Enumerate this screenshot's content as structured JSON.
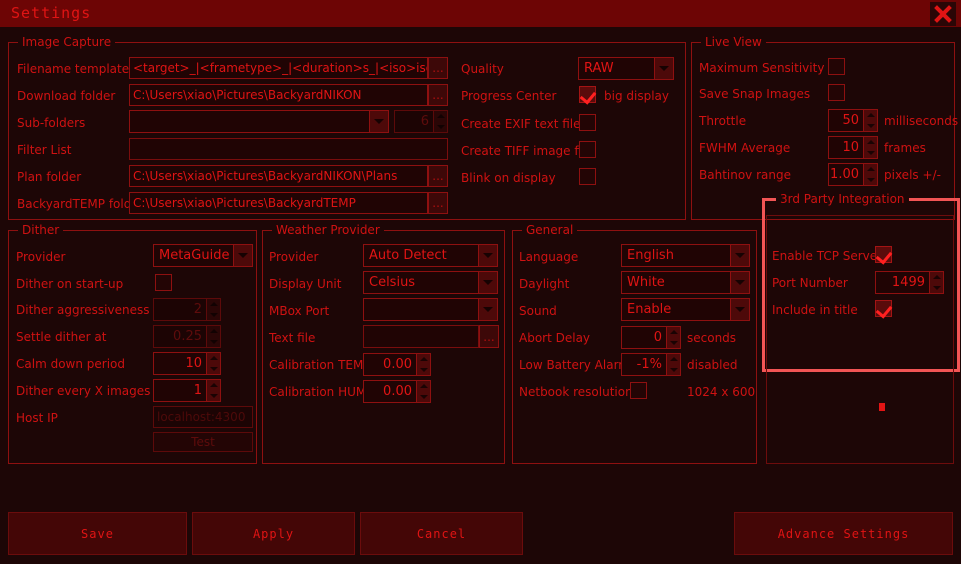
{
  "window": {
    "title": "Settings",
    "close_icon": "close-icon"
  },
  "image_capture": {
    "legend": "Image Capture",
    "filename_template_label": "Filename template",
    "filename_template_value": "<target>_|<frametype>_|<duration>s_|<iso>iso...",
    "download_folder_label": "Download folder",
    "download_folder_value": "C:\\Users\\xiao\\Pictures\\BackyardNIKON",
    "subfolders_label": "Sub-folders",
    "subfolders_value": "",
    "subfolders_count": "6",
    "filter_list_label": "Filter List",
    "filter_list_value": "",
    "plan_folder_label": "Plan folder",
    "plan_folder_value": "C:\\Users\\xiao\\Pictures\\BackyardNIKON\\Plans",
    "backyardtemp_folder_label": "BackyardTEMP folder",
    "backyardtemp_folder_value": "C:\\Users\\xiao\\Pictures\\BackyardTEMP",
    "browse_label": "...",
    "quality_label": "Quality",
    "quality_value": "RAW",
    "progress_center_label": "Progress Center",
    "progress_center_suffix": "big display",
    "progress_center_checked": true,
    "create_exif_label": "Create EXIF text file",
    "create_exif_checked": false,
    "create_tiff_label": "Create TIFF image file",
    "create_tiff_checked": false,
    "blink_label": "Blink on display",
    "blink_checked": false
  },
  "live_view": {
    "legend": "Live View",
    "max_sensitivity_label": "Maximum Sensitivity",
    "max_sensitivity_checked": false,
    "save_snap_label": "Save Snap Images",
    "save_snap_checked": false,
    "throttle_label": "Throttle",
    "throttle_value": "50",
    "throttle_unit": "milliseconds",
    "fwhm_label": "FWHM Average",
    "fwhm_value": "10",
    "fwhm_unit": "frames",
    "bahtinov_label": "Bahtinov range",
    "bahtinov_value": "1.00",
    "bahtinov_unit": "pixels +/-"
  },
  "dither": {
    "legend": "Dither",
    "provider_label": "Provider",
    "provider_value": "MetaGuide",
    "onstartup_label": "Dither on start-up",
    "onstartup_checked": false,
    "aggressiveness_label": "Dither aggressiveness",
    "aggressiveness_value": "2",
    "settle_label": "Settle dither at",
    "settle_value": "0.25",
    "calmdown_label": "Calm down period",
    "calmdown_value": "10",
    "every_label": "Dither every X images",
    "every_value": "1",
    "hostip_label": "Host IP",
    "hostip_value": "localhost:4300",
    "test_label": "Test"
  },
  "weather": {
    "legend": "Weather Provider",
    "provider_label": "Provider",
    "provider_value": "Auto Detect",
    "display_unit_label": "Display Unit",
    "display_unit_value": "Celsius",
    "mbox_port_label": "MBox Port",
    "mbox_port_value": "",
    "text_file_label": "Text file",
    "text_file_value": "",
    "browse_label": "...",
    "cal_temp_label": "Calibration TEMP",
    "cal_temp_value": "0.00",
    "cal_hum_label": "Calibration HUM",
    "cal_hum_value": "0.00"
  },
  "general": {
    "legend": "General",
    "language_label": "Language",
    "language_value": "English",
    "daylight_label": "Daylight",
    "daylight_value": "White",
    "sound_label": "Sound",
    "sound_value": "Enable",
    "abort_delay_label": "Abort Delay",
    "abort_delay_value": "0",
    "abort_delay_unit": "seconds",
    "low_battery_label": "Low Battery Alarm",
    "low_battery_value": "-1%",
    "low_battery_unit": "disabled",
    "netbook_label": "Netbook resolution",
    "netbook_checked": false,
    "netbook_resolution": "1024 x 600"
  },
  "third_party": {
    "legend": "3rd Party Integration",
    "enable_tcp_label": "Enable TCP Server",
    "enable_tcp_checked": true,
    "port_label": "Port Number",
    "port_value": "1499",
    "include_title_label": "Include in title",
    "include_title_checked": true,
    "highlight_color": "#f25555"
  },
  "footer": {
    "save_label": "Save",
    "apply_label": "Apply",
    "cancel_label": "Cancel",
    "advance_label": "Advance Settings"
  }
}
